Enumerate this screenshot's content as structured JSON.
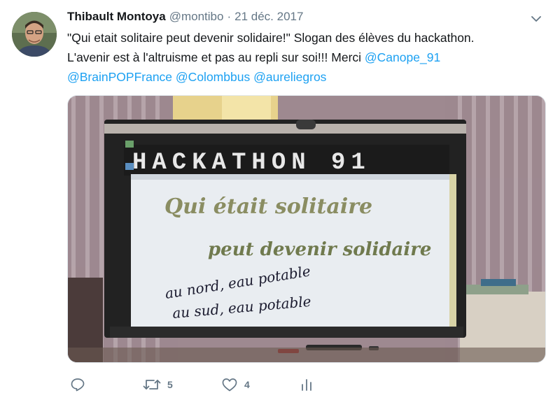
{
  "tweet": {
    "author": {
      "display_name": "Thibault Montoya",
      "handle": "@montibo"
    },
    "separator": "·",
    "date": "21 déc. 2017",
    "text_line1": "\"Qui etait solitaire peut devenir solidaire!\" Slogan des élèves du hackathon.",
    "text_line2_prefix": "L'avenir est à  l'altruisme et pas au repli sur soi!!! Merci ",
    "mentions": [
      "@Canope_91",
      "@BrainPOPFrance",
      "@Colombbus",
      "@aureliegros"
    ],
    "media": {
      "banner_text": "HACKATHON 91",
      "board_line1": "Qui était solitaire",
      "board_line2": "peut devenir solidaire",
      "board_line3": "au nord, eau potable",
      "board_line4": "au sud, eau potable"
    },
    "actions": {
      "retweet_count": "5",
      "like_count": "4"
    }
  },
  "colors": {
    "link": "#1da1f2",
    "muted": "#657786",
    "text": "#14171a"
  },
  "icons": [
    "avatar-photo",
    "chevron-down-icon",
    "reply-icon",
    "retweet-icon",
    "like-icon",
    "analytics-icon"
  ]
}
